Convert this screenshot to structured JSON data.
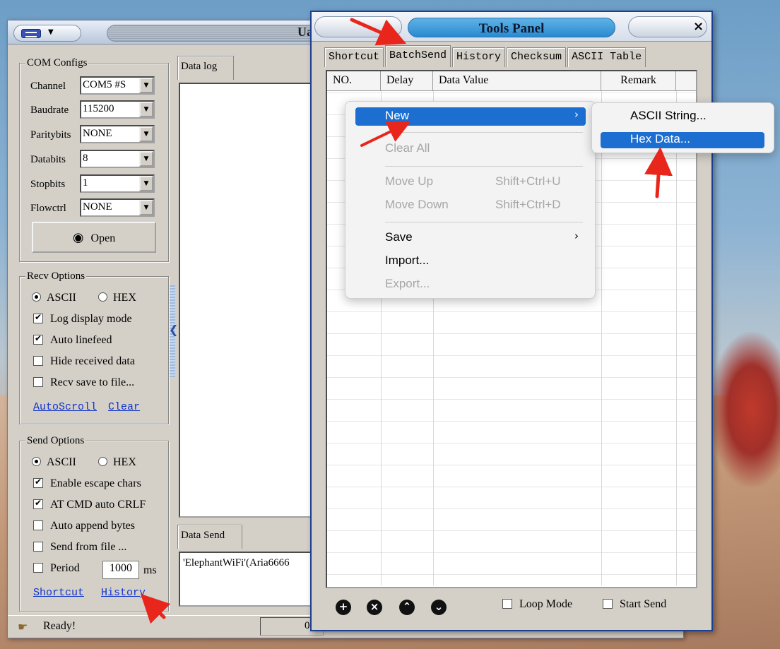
{
  "main_window": {
    "title_fragment": "Ua",
    "com_configs": {
      "title": "COM Configs",
      "rows": [
        {
          "label": "Channel",
          "value": "COM5 #S"
        },
        {
          "label": "Baudrate",
          "value": "115200"
        },
        {
          "label": "Paritybits",
          "value": "NONE"
        },
        {
          "label": "Databits",
          "value": "8"
        },
        {
          "label": "Stopbits",
          "value": "1"
        },
        {
          "label": "Flowctrl",
          "value": "NONE"
        }
      ],
      "open_label": "Open"
    },
    "recv_options": {
      "title": "Recv Options",
      "radio_ascii": "ASCII",
      "radio_hex": "HEX",
      "checks": [
        {
          "label": "Log display mode",
          "checked": true
        },
        {
          "label": "Auto linefeed",
          "checked": true
        },
        {
          "label": "Hide received data",
          "checked": false
        },
        {
          "label": "Recv save to file...",
          "checked": false
        }
      ],
      "link_autoscroll": "AutoScroll",
      "link_clear": "Clear"
    },
    "send_options": {
      "title": "Send Options",
      "radio_ascii": "ASCII",
      "radio_hex": "HEX",
      "checks": [
        {
          "label": "Enable escape chars",
          "checked": true
        },
        {
          "label": "AT CMD auto CRLF",
          "checked": true
        },
        {
          "label": "Auto append bytes",
          "checked": false
        },
        {
          "label": "Send from file ...",
          "checked": false
        }
      ],
      "period_label": "Period",
      "period_value": "1000",
      "period_unit": "ms",
      "link_shortcut": "Shortcut",
      "link_history": "History"
    },
    "data_log_tab": "Data log",
    "data_send_tab": "Data Send",
    "data_send_text": "'ElephantWiFi'(Aria6666",
    "status": {
      "text": "Ready!",
      "number": "0"
    }
  },
  "tools_panel": {
    "title": "Tools Panel",
    "close_glyph": "×",
    "tabs": [
      "Shortcut",
      "BatchSend",
      "History",
      "Checksum",
      "ASCII Table"
    ],
    "active_tab": "BatchSend",
    "columns": [
      "NO.",
      "Delay",
      "Data Value",
      "Remark"
    ],
    "loop_mode": "Loop Mode",
    "start_send": "Start Send"
  },
  "context_menu": {
    "new": "New",
    "clear_all": "Clear All",
    "move_up": "Move Up",
    "move_up_shortcut": "Shift+Ctrl+U",
    "move_down": "Move Down",
    "move_down_shortcut": "Shift+Ctrl+D",
    "save": "Save",
    "import": "Import...",
    "export": "Export..."
  },
  "submenu": {
    "ascii_string": "ASCII String...",
    "hex_data": "Hex Data..."
  },
  "colors": {
    "menu_highlight": "#1c6fd1",
    "link": "#1033cc",
    "annotation_arrow": "#e8261c"
  }
}
